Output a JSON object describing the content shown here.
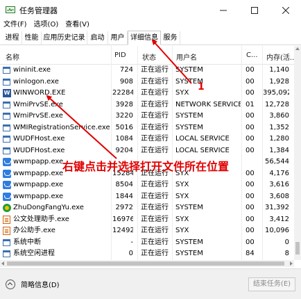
{
  "window": {
    "title": "任务管理器"
  },
  "menu": [
    "文件(F)",
    "选项(O)",
    "查看(V)"
  ],
  "tabs": [
    {
      "label": "进程",
      "active": false
    },
    {
      "label": "性能",
      "active": false
    },
    {
      "label": "应用历史记录",
      "active": false
    },
    {
      "label": "启动",
      "active": false
    },
    {
      "label": "用户",
      "active": false
    },
    {
      "label": "详细信息",
      "active": true
    },
    {
      "label": "服务",
      "active": false
    }
  ],
  "columns": {
    "name": "名称",
    "pid": "PID",
    "status": "状态",
    "user": "用户名",
    "cpu": "C...",
    "mem": "内存(活..."
  },
  "rows": [
    {
      "icon": "window-icon",
      "name": "wininit.exe",
      "pid": "724",
      "status": "正在运行",
      "user": "SYSTEM",
      "cpu": "00",
      "mem": "1,140"
    },
    {
      "icon": "window-icon",
      "name": "winlogon.exe",
      "pid": "908",
      "status": "正在运行",
      "user": "SYSTEM",
      "cpu": "00",
      "mem": "1,928"
    },
    {
      "icon": "word-icon",
      "name": "WINWORD.EXE",
      "pid": "22284",
      "status": "正在运行",
      "user": "SYX",
      "cpu": "00",
      "mem": "395,092"
    },
    {
      "icon": "window-icon",
      "name": "WmiPrvSE.exe",
      "pid": "3928",
      "status": "正在运行",
      "user": "NETWORK SERVICE",
      "cpu": "01",
      "mem": "12,728"
    },
    {
      "icon": "window-icon",
      "name": "WmiPrvSE.exe",
      "pid": "3220",
      "status": "正在运行",
      "user": "SYSTEM",
      "cpu": "00",
      "mem": "3,860"
    },
    {
      "icon": "window-icon",
      "name": "WMIRegistrationService.exe",
      "pid": "5016",
      "status": "正在运行",
      "user": "SYSTEM",
      "cpu": "00",
      "mem": "1,352"
    },
    {
      "icon": "window-icon",
      "name": "WUDFHost.exe",
      "pid": "1084",
      "status": "正在运行",
      "user": "LOCAL SERVICE",
      "cpu": "00",
      "mem": "1,280"
    },
    {
      "icon": "window-icon",
      "name": "WUDFHost.exe",
      "pid": "9204",
      "status": "正在运行",
      "user": "LOCAL SERVICE",
      "cpu": "00",
      "mem": "1,384"
    },
    {
      "icon": "wwmp-icon",
      "name": "wwmpapp.exe",
      "pid": "",
      "status": "",
      "user": "",
      "cpu": "",
      "mem": "56,544"
    },
    {
      "icon": "wwmp-icon",
      "name": "wwmpapp.exe",
      "pid": "15284",
      "status": "正在运行",
      "user": "SYX",
      "cpu": "00",
      "mem": "4,176"
    },
    {
      "icon": "wwmp-icon",
      "name": "wwmpapp.exe",
      "pid": "8504",
      "status": "正在运行",
      "user": "SYX",
      "cpu": "00",
      "mem": "3,616"
    },
    {
      "icon": "wwmp-icon",
      "name": "wwmpapp.exe",
      "pid": "1844",
      "status": "正在运行",
      "user": "SYX",
      "cpu": "00",
      "mem": "3,608"
    },
    {
      "icon": "zhudong-icon",
      "name": "ZhuDongFangYu.exe",
      "pid": "2972",
      "status": "正在运行",
      "user": "SYSTEM",
      "cpu": "00",
      "mem": "31,392"
    },
    {
      "icon": "document-icon",
      "name": "公文处理助手.exe",
      "pid": "16976",
      "status": "正在运行",
      "user": "SYX",
      "cpu": "00",
      "mem": "3,412"
    },
    {
      "icon": "document-icon",
      "name": "办公助手.exe",
      "pid": "12492",
      "status": "正在运行",
      "user": "SYX",
      "cpu": "00",
      "mem": "10,096"
    },
    {
      "icon": "window-icon",
      "name": "系统中断",
      "pid": "-",
      "status": "正在运行",
      "user": "SYSTEM",
      "cpu": "00",
      "mem": "0"
    },
    {
      "icon": "window-icon",
      "name": "系统空闲进程",
      "pid": "0",
      "status": "正在运行",
      "user": "SYSTEM",
      "cpu": "84",
      "mem": "8"
    }
  ],
  "footer": {
    "fewer_details": "简略信息(D)",
    "end_task": "结束任务(E)"
  },
  "annotation": {
    "text": "右键点击并选择打开文件所在位置",
    "marker": "1",
    "color": "#e00000"
  }
}
